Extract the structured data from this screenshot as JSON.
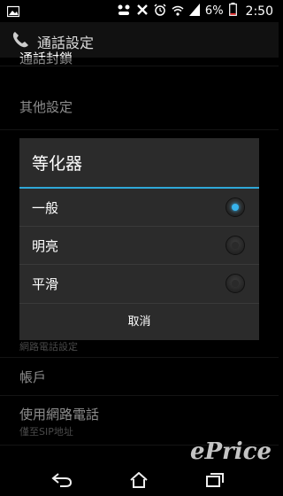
{
  "status_bar": {
    "battery": "6%",
    "time": "2:50",
    "icons": [
      "image-icon",
      "bbm-icon",
      "x-icon",
      "alarm-icon",
      "wifi-icon",
      "signal-icon",
      "battery-icon"
    ]
  },
  "action_bar": {
    "title": "通話設定",
    "icon": "phone-handset-icon"
  },
  "background_list": {
    "top_partial": "通話封鎖",
    "other_settings": "其他設定",
    "internet_call_header": "網路電話設定",
    "accounts": "帳戶",
    "use_internet_call": "使用網路電話",
    "use_internet_call_sub": "僅至SIP地址"
  },
  "dialog": {
    "title": "等化器",
    "options": [
      {
        "label": "一般",
        "selected": true
      },
      {
        "label": "明亮",
        "selected": false
      },
      {
        "label": "平滑",
        "selected": false
      }
    ],
    "cancel": "取消"
  },
  "nav_bar": {
    "icons": [
      "back-icon",
      "home-icon",
      "recent-apps-icon"
    ]
  },
  "watermark": "ePrice",
  "colors": {
    "accent": "#37b3ec",
    "dialog_bg": "#2b2b2b"
  }
}
